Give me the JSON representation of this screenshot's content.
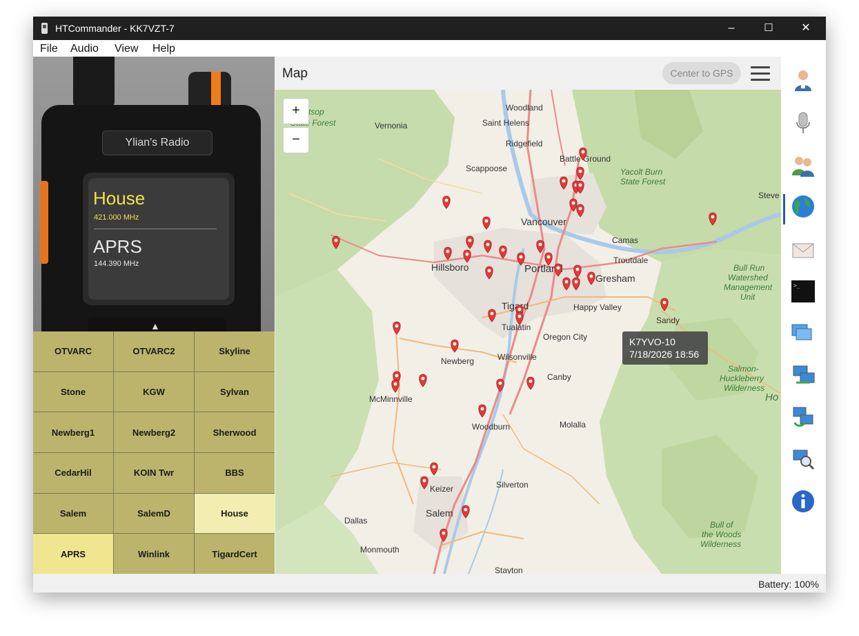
{
  "window": {
    "title": "HTCommander - KK7VZT-7",
    "minimize": "–",
    "maximize": "☐",
    "close": "✕"
  },
  "menu": [
    "File",
    "Audio",
    "View",
    "Help"
  ],
  "radio": {
    "name": "Ylian's Radio",
    "channel_a": {
      "name": "House",
      "freq": "421.000 MHz"
    },
    "channel_b": {
      "name": "APRS",
      "freq": "144.390 MHz"
    }
  },
  "channels": [
    {
      "label": "OTVARC"
    },
    {
      "label": "OTVARC2"
    },
    {
      "label": "Skyline"
    },
    {
      "label": "Stone"
    },
    {
      "label": "KGW"
    },
    {
      "label": "Sylvan"
    },
    {
      "label": "Newberg1"
    },
    {
      "label": "Newberg2"
    },
    {
      "label": "Sherwood"
    },
    {
      "label": "CedarHil"
    },
    {
      "label": "KOIN Twr"
    },
    {
      "label": "BBS"
    },
    {
      "label": "Salem"
    },
    {
      "label": "SalemD"
    },
    {
      "label": "House"
    },
    {
      "label": "APRS"
    },
    {
      "label": "Winlink"
    },
    {
      "label": "TigardCert"
    }
  ],
  "map": {
    "title": "Map",
    "center_gps_label": "Center to GPS",
    "zoom_in": "+",
    "zoom_out": "−",
    "tooltip": {
      "callsign": "K7YVO-10",
      "time": "7/18/2026 18:56"
    },
    "place_labels": [
      {
        "name": "Woodland",
        "big": false
      },
      {
        "name": "Saint Helens",
        "big": false
      },
      {
        "name": "Vernonia",
        "big": false
      },
      {
        "name": "Ridgefield",
        "big": false
      },
      {
        "name": "Battle Ground",
        "big": false
      },
      {
        "name": "Scappoose",
        "big": false
      },
      {
        "name": "Vancouver",
        "big": true
      },
      {
        "name": "Camas",
        "big": false
      },
      {
        "name": "Hillsboro",
        "big": true
      },
      {
        "name": "Portland",
        "big": true
      },
      {
        "name": "Troutdale",
        "big": false
      },
      {
        "name": "Gresham",
        "big": true
      },
      {
        "name": "Tigard",
        "big": true
      },
      {
        "name": "Happy Valley",
        "big": false
      },
      {
        "name": "Sandy",
        "big": false
      },
      {
        "name": "Tualatin",
        "big": false
      },
      {
        "name": "Oregon City",
        "big": false
      },
      {
        "name": "Newberg",
        "big": false
      },
      {
        "name": "Wilsonville",
        "big": false
      },
      {
        "name": "Canby",
        "big": false
      },
      {
        "name": "McMinnville",
        "big": false
      },
      {
        "name": "Woodburn",
        "big": false
      },
      {
        "name": "Molalla",
        "big": false
      },
      {
        "name": "Silverton",
        "big": false
      },
      {
        "name": "Keizer",
        "big": false
      },
      {
        "name": "Salem",
        "big": true
      },
      {
        "name": "Dallas",
        "big": false
      },
      {
        "name": "Monmouth",
        "big": false
      },
      {
        "name": "Stayton",
        "big": false
      },
      {
        "name": "Steve",
        "big": false
      }
    ],
    "area_labels": [
      "Clatsop",
      "State Forest",
      "Yacolt Burn",
      "State Forest",
      "Bull Run",
      "Watershed",
      "Management",
      "Unit",
      "Salmon-",
      "Huckleberry",
      "Wilderness",
      "Bull of",
      "the Woods",
      "Wilderness",
      "Ho"
    ]
  },
  "sidebar_icons": [
    "contacts-icon",
    "microphone-icon",
    "users-icon",
    "globe-icon",
    "mail-icon",
    "terminal-icon",
    "windows-icon",
    "network-icon",
    "network-sync-icon",
    "network-search-icon",
    "info-icon"
  ],
  "status": {
    "battery": "Battery: 100%"
  },
  "colors": {
    "marker": "#e53935",
    "channel_button": "#bcb46c",
    "channel_selected": "#f0e68f",
    "map_green": "#c8ddb0"
  }
}
